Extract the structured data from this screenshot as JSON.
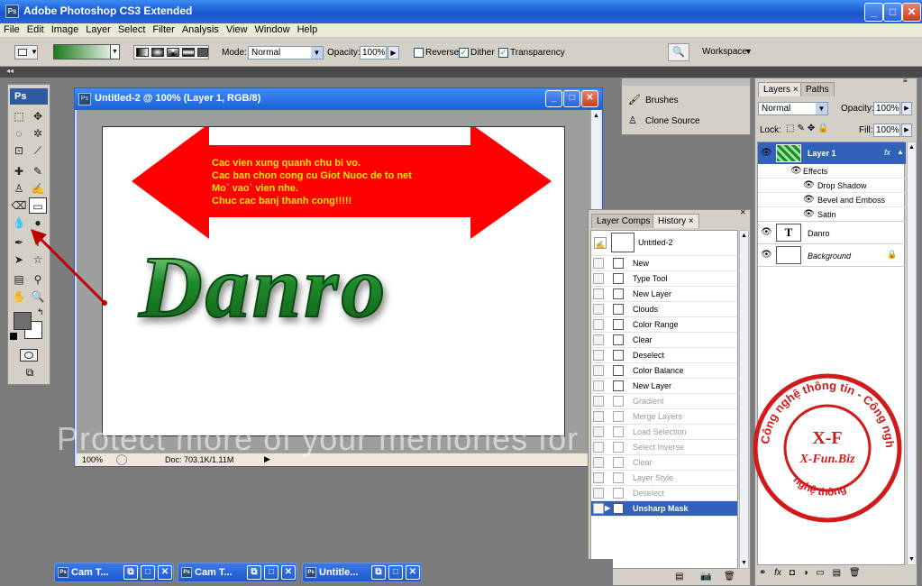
{
  "window": {
    "title": "Adobe Photoshop CS3 Extended",
    "app_badge": "Ps"
  },
  "menu": [
    "File",
    "Edit",
    "Image",
    "Layer",
    "Select",
    "Filter",
    "Analysis",
    "View",
    "Window",
    "Help"
  ],
  "options": {
    "mode_label": "Mode:",
    "mode_value": "Normal",
    "opacity_label": "Opacity:",
    "opacity_value": "100%",
    "reverse_label": "Reverse",
    "dither_label": "Dither",
    "transparency_label": "Transparency",
    "workspace_label": "Workspace"
  },
  "tools": {
    "header": "Ps"
  },
  "document": {
    "title": "Untitled-2 @ 100% (Layer 1, RGB/8)",
    "zoom": "100%",
    "doc_info": "Doc: 703.1K/1.11M",
    "arrow_text": [
      "Cac vien xung quanh chu bi vo.",
      "Cac ban chon cong cu Giot Nuoc de to net",
      "Mo` vao` vien nhe.",
      "Chuc cac banj thanh cong!!!!!"
    ],
    "big_text": "Danro"
  },
  "brushes": {
    "brushes_label": "Brushes",
    "clone_label": "Clone Source"
  },
  "history": {
    "tabs": [
      "Layer Comps",
      "History"
    ],
    "snapshot": "Untitled-2",
    "items": [
      {
        "label": "New",
        "state": "normal"
      },
      {
        "label": "Type Tool",
        "state": "normal"
      },
      {
        "label": "New Layer",
        "state": "normal"
      },
      {
        "label": "Clouds",
        "state": "normal"
      },
      {
        "label": "Color Range",
        "state": "normal"
      },
      {
        "label": "Clear",
        "state": "normal"
      },
      {
        "label": "Deselect",
        "state": "normal"
      },
      {
        "label": "Color Balance",
        "state": "normal"
      },
      {
        "label": "New Layer",
        "state": "normal"
      },
      {
        "label": "Gradient",
        "state": "dim"
      },
      {
        "label": "Merge Layers",
        "state": "dim"
      },
      {
        "label": "Load Selection",
        "state": "dim"
      },
      {
        "label": "Select Inverse",
        "state": "dim"
      },
      {
        "label": "Clear",
        "state": "dim"
      },
      {
        "label": "Layer Style",
        "state": "dim"
      },
      {
        "label": "Deselect",
        "state": "dim"
      },
      {
        "label": "Unsharp Mask",
        "state": "selected"
      }
    ]
  },
  "layers": {
    "tabs": [
      "Layers",
      "Paths"
    ],
    "blend_mode": "Normal",
    "opacity_label": "Opacity:",
    "opacity_value": "100%",
    "lock_label": "Lock:",
    "fill_label": "Fill:",
    "fill_value": "100%",
    "layer1": "Layer 1",
    "effects": "Effects",
    "effect_items": [
      "Drop Shadow",
      "Bevel and Emboss",
      "Satin"
    ],
    "text_layer": "Danro",
    "background": "Background"
  },
  "taskbar": [
    "Cam T...",
    "Cam T...",
    "Untitle..."
  ],
  "watermark": "Protect more of your memories for",
  "stamp": {
    "top_text": "Công nghệ thông tin - Công nghệ thông",
    "center_top": "X-F",
    "center_bottom": "X-Fun.Biz",
    "bottom_text": "nghệ thông"
  },
  "colors": {
    "accent": "#1d5fd6",
    "arrow": "#ff0000",
    "arrow_text": "#ffe600",
    "stamp": "#d31a1a",
    "history_selected": "#3161b9"
  }
}
